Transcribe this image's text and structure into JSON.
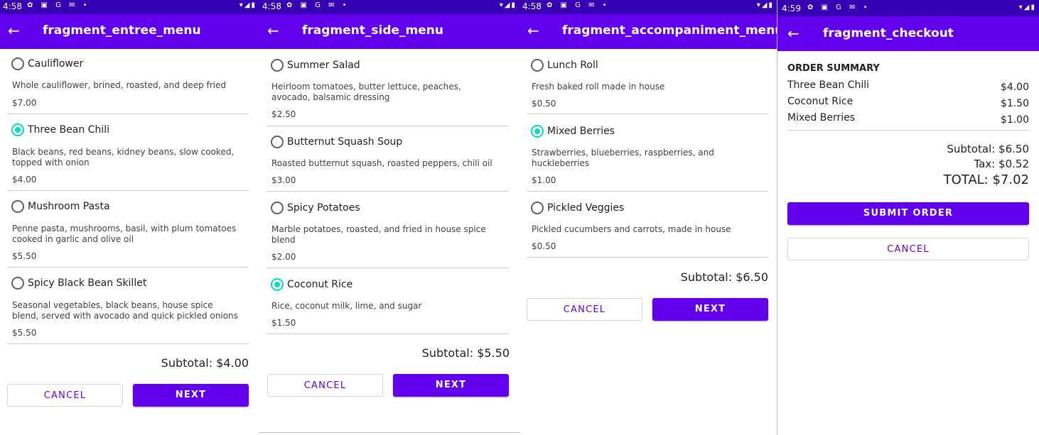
{
  "colors": {
    "primary": "#6200ee",
    "primary_dark": "#3700b3",
    "accent": "#03dac5"
  },
  "screens": [
    {
      "status_time": "4:58",
      "title": "fragment_entree_menu",
      "items": [
        {
          "name": "Cauliflower",
          "desc": "Whole cauliflower, brined, roasted, and deep fried",
          "price": "$7.00",
          "selected": false
        },
        {
          "name": "Three Bean Chili",
          "desc": "Black beans, red beans, kidney beans, slow cooked, topped with onion",
          "price": "$4.00",
          "selected": true
        },
        {
          "name": "Mushroom Pasta",
          "desc": "Penne pasta, mushrooms, basil, with plum tomatoes cooked in garlic and olive oil",
          "price": "$5.50",
          "selected": false
        },
        {
          "name": "Spicy Black Bean Skillet",
          "desc": "Seasonal vegetables, black beans, house spice blend, served with avocado and quick pickled onions",
          "price": "$5.50",
          "selected": false
        }
      ],
      "subtotal": "Subtotal: $4.00",
      "cancel_label": "CANCEL",
      "next_label": "NEXT"
    },
    {
      "status_time": "4:58",
      "title": "fragment_side_menu",
      "items": [
        {
          "name": "Summer Salad",
          "desc": "Heirloom tomatoes, butter lettuce, peaches, avocado, balsamic dressing",
          "price": "$2.50",
          "selected": false
        },
        {
          "name": "Butternut Squash Soup",
          "desc": "Roasted butternut squash, roasted peppers, chili oil",
          "price": "$3.00",
          "selected": false
        },
        {
          "name": "Spicy Potatoes",
          "desc": "Marble potatoes, roasted, and fried in house spice blend",
          "price": "$2.00",
          "selected": false
        },
        {
          "name": "Coconut Rice",
          "desc": "Rice, coconut milk, lime, and sugar",
          "price": "$1.50",
          "selected": true
        }
      ],
      "subtotal": "Subtotal: $5.50",
      "cancel_label": "CANCEL",
      "next_label": "NEXT"
    },
    {
      "status_time": "4:58",
      "title": "fragment_accompaniment_menu",
      "items": [
        {
          "name": "Lunch Roll",
          "desc": "Fresh baked roll made in house",
          "price": "$0.50",
          "selected": false
        },
        {
          "name": "Mixed Berries",
          "desc": "Strawberries, blueberries, raspberries, and huckleberries",
          "price": "$1.00",
          "selected": true
        },
        {
          "name": "Pickled Veggies",
          "desc": "Pickled cucumbers and carrots, made in house",
          "price": "$0.50",
          "selected": false
        }
      ],
      "subtotal": "Subtotal: $6.50",
      "cancel_label": "CANCEL",
      "next_label": "NEXT"
    }
  ],
  "checkout": {
    "status_time": "4:59",
    "title": "fragment_checkout",
    "summary_heading": "ORDER SUMMARY",
    "lines": [
      {
        "name": "Three Bean Chili",
        "price": "$4.00"
      },
      {
        "name": "Coconut Rice",
        "price": "$1.50"
      },
      {
        "name": "Mixed Berries",
        "price": "$1.00"
      }
    ],
    "subtotal": "Subtotal: $6.50",
    "tax": "Tax: $0.52",
    "total": "TOTAL: $7.02",
    "submit_label": "SUBMIT ORDER",
    "cancel_label": "CANCEL"
  }
}
